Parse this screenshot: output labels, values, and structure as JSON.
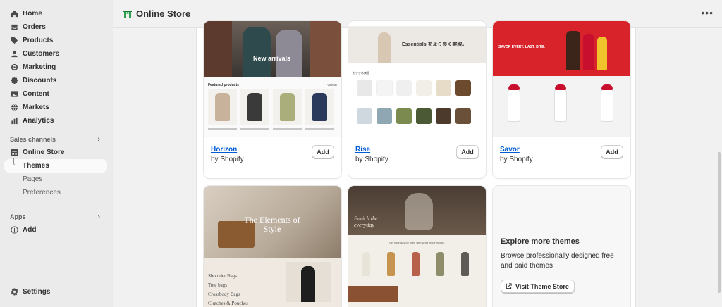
{
  "header": {
    "title": "Online Store",
    "more_label": "•••"
  },
  "sidebar": {
    "items": [
      {
        "label": "Home",
        "icon": "home-icon"
      },
      {
        "label": "Orders",
        "icon": "orders-icon"
      },
      {
        "label": "Products",
        "icon": "tag-icon"
      },
      {
        "label": "Customers",
        "icon": "person-icon"
      },
      {
        "label": "Marketing",
        "icon": "target-icon"
      },
      {
        "label": "Discounts",
        "icon": "discount-icon"
      },
      {
        "label": "Content",
        "icon": "image-icon"
      },
      {
        "label": "Markets",
        "icon": "globe-icon"
      },
      {
        "label": "Analytics",
        "icon": "chart-icon"
      }
    ],
    "sales_channels": {
      "heading": "Sales channels",
      "online_store": "Online Store",
      "themes": "Themes",
      "pages": "Pages",
      "preferences": "Preferences"
    },
    "apps": {
      "heading": "Apps",
      "add": "Add"
    },
    "settings": "Settings"
  },
  "themes": [
    {
      "name": "Horizon",
      "by": "by Shopify",
      "add": "Add",
      "hero_text": "New arrivals",
      "featured": "Featured products",
      "view_all": "View all"
    },
    {
      "name": "Rise",
      "by": "by Shopify",
      "add": "Add",
      "hero_text": "Essentials をより良く実現。",
      "caption": "おすすめ商品"
    },
    {
      "name": "Savor",
      "by": "by Shopify",
      "add": "Add",
      "hero_text": "SAVOR EVERY. LAST. BITE."
    }
  ],
  "lower_cards": [
    {
      "headline": "The Elements of Style",
      "list": [
        "Shoulder Bags",
        "Tote bags",
        "Crossbody Bags",
        "Clutches & Pouches"
      ]
    },
    {
      "headline": "Enrich the everyday",
      "sub": "Let your day be filled with what inspires you."
    }
  ],
  "explore": {
    "title": "Explore more themes",
    "description": "Browse professionally designed free and paid themes",
    "button": "Visit Theme Store"
  },
  "colors": {
    "accent": "#005bd3",
    "sidebar_bg": "#ebebeb",
    "main_bg": "#f1f1f1",
    "savor_red": "#d8232a"
  }
}
